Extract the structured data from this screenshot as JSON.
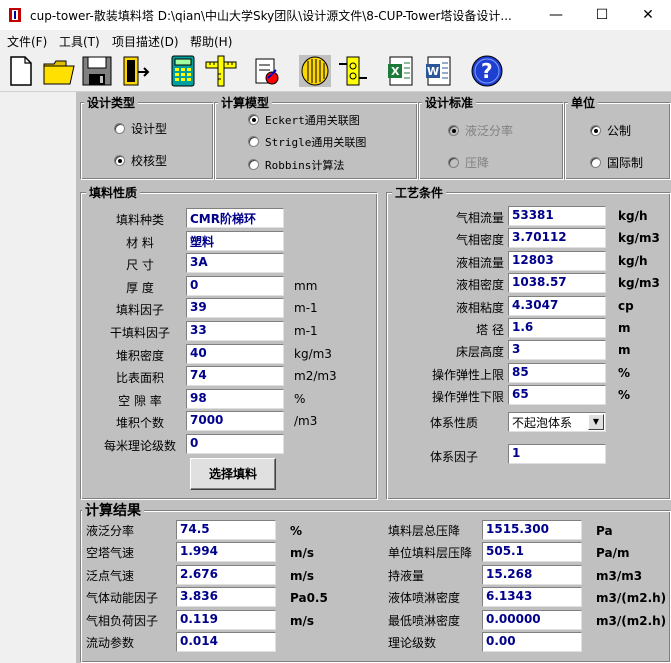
{
  "window": {
    "title": "cup-tower-散装填料塔    D:\\qian\\中山大学Sky团队\\设计源文件\\8-CUP-Tower塔设备设计...",
    "minimize": "—",
    "maximize": "☐",
    "close": "✕"
  },
  "menu": [
    "文件(F)",
    "工具(T)",
    "项目描述(D)",
    "帮助(H)"
  ],
  "toolbar": [
    {
      "name": "new-icon"
    },
    {
      "name": "open-folder-icon"
    },
    {
      "name": "save-disk-icon"
    },
    {
      "name": "exit-door-icon"
    },
    {
      "name": "calculator-icon"
    },
    {
      "name": "ruler-icon"
    },
    {
      "name": "edit-document-icon"
    },
    {
      "name": "distributor-icon"
    },
    {
      "name": "tower-packing-icon"
    },
    {
      "name": "excel-icon"
    },
    {
      "name": "word-icon"
    },
    {
      "name": "help-icon"
    }
  ],
  "design_type": {
    "title": "设计类型",
    "options": [
      "设计型",
      "校核型"
    ],
    "selected": "校核型"
  },
  "calc_model": {
    "title": "计算模型",
    "options": [
      "Eckert通用关联图",
      "Strigle通用关联图",
      "Robbins计算法"
    ],
    "selected": "Eckert通用关联图"
  },
  "design_std": {
    "title": "设计标准",
    "options": [
      "液泛分率",
      "压降"
    ],
    "selected": "液泛分率"
  },
  "unit": {
    "title": "单位",
    "options": [
      "公制",
      "国际制"
    ],
    "selected": "公制"
  },
  "packing": {
    "title": "填料性质",
    "rows": [
      {
        "label": "填料种类",
        "value": "CMR阶梯环",
        "unit": ""
      },
      {
        "label": "材  料",
        "value": "塑料",
        "unit": ""
      },
      {
        "label": "尺  寸",
        "value": "3A",
        "unit": ""
      },
      {
        "label": "厚  度",
        "value": "0",
        "unit": "mm"
      },
      {
        "label": "填料因子",
        "value": "39",
        "unit": "m-1"
      },
      {
        "label": "干填料因子",
        "value": "33",
        "unit": "m-1"
      },
      {
        "label": "堆积密度",
        "value": "40",
        "unit": "kg/m3"
      },
      {
        "label": "比表面积",
        "value": "74",
        "unit": "m2/m3"
      },
      {
        "label": "空 隙 率",
        "value": "98",
        "unit": "%"
      },
      {
        "label": "堆积个数",
        "value": "7000",
        "unit": "/m3"
      },
      {
        "label": "每米理论级数",
        "value": "0",
        "unit": ""
      }
    ],
    "select_button": "选择填料"
  },
  "process": {
    "title": "工艺条件",
    "rows": [
      {
        "label": "气相流量",
        "value": "53381",
        "unit": "kg/h"
      },
      {
        "label": "气相密度",
        "value": "3.70112",
        "unit": "kg/m3"
      },
      {
        "label": "液相流量",
        "value": "12803",
        "unit": "kg/h"
      },
      {
        "label": "液相密度",
        "value": "1038.57",
        "unit": "kg/m3"
      },
      {
        "label": "液相粘度",
        "value": "4.3047",
        "unit": "cp"
      },
      {
        "label": "塔   径",
        "value": "1.6",
        "unit": "m"
      },
      {
        "label": "床层高度",
        "value": "3",
        "unit": "m"
      },
      {
        "label": "操作弹性上限",
        "value": "85",
        "unit": "%"
      },
      {
        "label": "操作弹性下限",
        "value": "65",
        "unit": "%"
      }
    ],
    "system_label": "体系性质",
    "system_value": "不起泡体系",
    "factor_label": "体系因子",
    "factor_value": "1"
  },
  "results": {
    "title": "计算结果",
    "left": [
      {
        "label": "液泛分率",
        "value": "74.5",
        "unit": "%"
      },
      {
        "label": "空塔气速",
        "value": "1.994",
        "unit": "m/s"
      },
      {
        "label": "泛点气速",
        "value": "2.676",
        "unit": "m/s"
      },
      {
        "label": "气体动能因子",
        "value": "3.836",
        "unit": "Pa0.5"
      },
      {
        "label": "气相负荷因子",
        "value": "0.119",
        "unit": "m/s"
      },
      {
        "label": "流动参数",
        "value": "0.014",
        "unit": ""
      }
    ],
    "right": [
      {
        "label": "填料层总压降",
        "value": "1515.300",
        "unit": "Pa"
      },
      {
        "label": "单位填料层压降",
        "value": "505.1",
        "unit": "Pa/m"
      },
      {
        "label": "持液量",
        "value": "15.268",
        "unit": "m3/m3"
      },
      {
        "label": "液体喷淋密度",
        "value": "6.1343",
        "unit": "m3/(m2.h)"
      },
      {
        "label": "最低喷淋密度",
        "value": "0.00000",
        "unit": "m3/(m2.h)"
      },
      {
        "label": "理论级数",
        "value": "0.00",
        "unit": ""
      }
    ]
  }
}
